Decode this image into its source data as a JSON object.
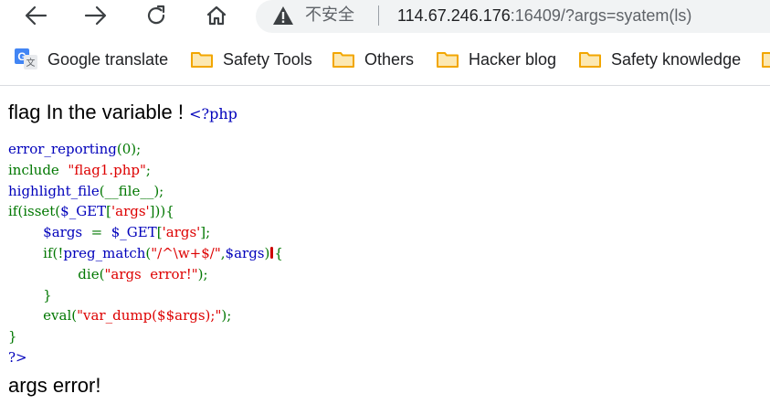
{
  "browser": {
    "insecure_label": "不安全",
    "url_host": "114.67.246.176",
    "url_rest": ":16409/?args=syatem(ls)",
    "bookmarks": [
      {
        "label": "Google translate",
        "icon": "google-translate-icon"
      },
      {
        "label": "Safety Tools",
        "icon": "folder-icon"
      },
      {
        "label": "Others",
        "icon": "folder-icon"
      },
      {
        "label": "Hacker blog",
        "icon": "folder-icon"
      },
      {
        "label": "Safety knowledge",
        "icon": "folder-icon"
      }
    ],
    "icons": {
      "back": "back-arrow-icon",
      "forward": "forward-arrow-icon",
      "reload": "reload-icon",
      "home": "home-icon",
      "warning": "warning-triangle-icon"
    }
  },
  "page": {
    "heading": "flag In the variable ! ",
    "php_open": "<?php",
    "code": {
      "l1_fn": "error_reporting",
      "l1_args": "(0);",
      "l2_kw": "include",
      "l2_str": "\"flag1.php\"",
      "l2_end": ";",
      "l3_fn": "highlight_file",
      "l3_args": "(__file__);",
      "l4_kw": "if(isset(",
      "l4_var": "$_GET",
      "l4_open": "[",
      "l4_str": "'args'",
      "l4_close": "])){",
      "l5_var": "$args",
      "l5_eq": "  =  ",
      "l5_get": "$_GET",
      "l5_open": "[",
      "l5_str": "'args'",
      "l5_close": "];",
      "l6_kw": "if(!",
      "l6_fn": "preg_match",
      "l6_open": "(",
      "l6_str": "\"/^\\w+$/\"",
      "l6_comma": ",",
      "l6_var": "$args",
      "l6_close": ")",
      "l6_brace": "{",
      "l7_kw": "die(",
      "l7_str": "\"args  error!\"",
      "l7_end": ");",
      "l8": "}",
      "l9_kw": "eval(",
      "l9_str": "\"var_dump($$args);\"",
      "l9_end": ");",
      "l10": "}",
      "l11": "?>"
    },
    "result": "args error!"
  },
  "colors": {
    "php_default": "#0000bb",
    "php_keyword": "#007700",
    "php_string": "#dd0000"
  }
}
